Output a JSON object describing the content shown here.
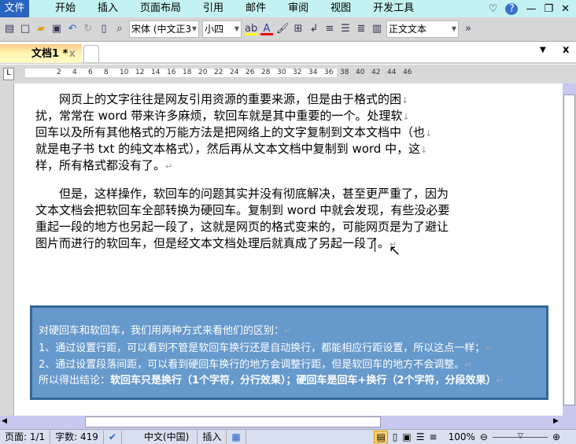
{
  "menu": [
    "文件",
    "开始",
    "插入",
    "页面布局",
    "引用",
    "邮件",
    "审阅",
    "视图",
    "开发工具"
  ],
  "toolbar": {
    "font": "宋体 (中文正3",
    "size": "小四",
    "style": "正文文本"
  },
  "tab": {
    "title": "文档1 *"
  },
  "ruler": [
    "2",
    "4",
    "6",
    "8",
    "10",
    "12",
    "14",
    "16",
    "18",
    "20",
    "22",
    "24",
    "26",
    "28",
    "30",
    "32",
    "34",
    "36",
    "38",
    "40",
    "42",
    "44",
    "46"
  ],
  "doc": {
    "p1": [
      "　　网页上的文字往往是网友引用资源的重要来源，但是由于格式的困",
      "扰，常常在 word 带来许多麻烦，软回车就是其中重要的一个。处理软",
      "回车以及所有其他格式的万能方法是把网络上的文字复制到文本文档中（也",
      "就是电子书 txt 的纯文本格式），然后再从文本文档中复制到 word 中，这",
      "样，所有格式都没有了。"
    ],
    "p2": [
      "　　但是，这样操作，软回车的问题其实并没有彻底解决，甚至更严重了，因为",
      "文本文档会把软回车全部转换为硬回车。复制到 word 中就会发现，有些没必要",
      "重起一段的地方也另起一段了，这就是网页的格式变来的，可能网页是为了避让",
      "图片而进行的软回车，但是经文本文档处理后就真成了另起一段了。"
    ],
    "soft": "↓",
    "hard": "↵"
  },
  "box": {
    "l1": "对硬回车和软回车，我们用两种方式来看他们的区别：",
    "l2": "1、通过设置行距，可以看到不管是软回车换行还是自动换行，都能相应行距设置，所以这点一样；",
    "l3": "2、通过设置段落间距，可以看到硬回车换行的地方会调整行距，但是软回车的地方不会调整。",
    "l4a": "所以得出结论：",
    "l4b": "软回车只是换行（1个字符，分行效果）；硬回车是回车+换行（2个字符，分段效果）"
  },
  "status": {
    "page": "页面: 1/1",
    "words": "字数: 419",
    "lang": "中文(中国)",
    "mode": "插入",
    "zoom": "100%"
  }
}
